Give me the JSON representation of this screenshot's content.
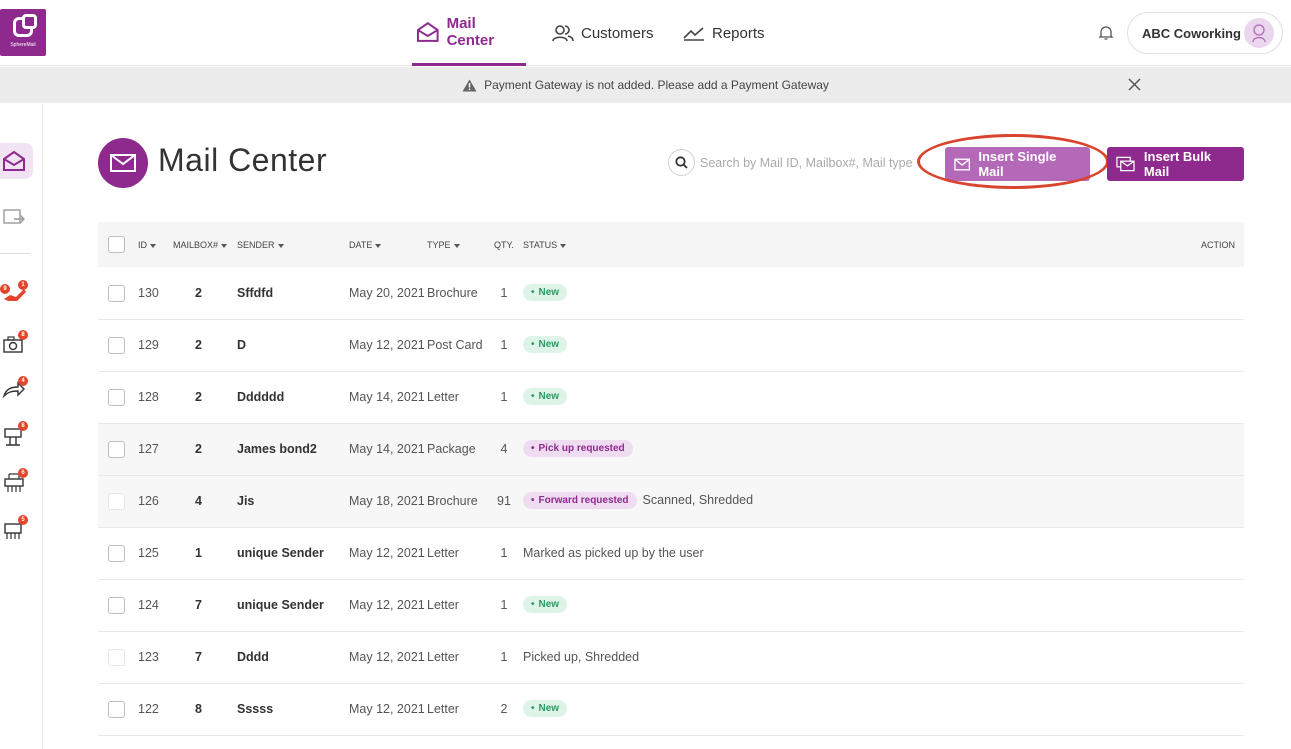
{
  "app": {
    "logo_text": "SphereMail",
    "brand_color": "#8e2a8e",
    "accent_light": "#b369b8"
  },
  "nav": {
    "items": [
      {
        "label": "Mail Center",
        "icon": "envelope-icon",
        "active": true
      },
      {
        "label": "Customers",
        "icon": "users-icon"
      },
      {
        "label": "Reports",
        "icon": "trend-line-icon"
      }
    ],
    "account_name": "ABC Coworking"
  },
  "banner": {
    "message": "Payment Gateway is not added. Please add a  Payment Gateway"
  },
  "rail": {
    "badges": [
      "9",
      "1",
      "8",
      "4",
      "8",
      "6",
      "5"
    ]
  },
  "page": {
    "title": "Mail Center",
    "search_placeholder": "Search by Mail ID, Mailbox#, Mail type",
    "insert_single_label": "Insert Single Mail",
    "insert_bulk_label": "Insert Bulk Mail"
  },
  "table": {
    "headers": {
      "id": "ID",
      "mailbox": "MAILBOX#",
      "sender": "SENDER",
      "date": "DATE",
      "type": "TYPE",
      "qty": "QTY.",
      "status": "STATUS",
      "action": "ACTION"
    },
    "rows": [
      {
        "id": "130",
        "mailbox": "2",
        "sender": "Sffdfd",
        "date": "May 20, 2021",
        "type": "Brochure",
        "qty": "1",
        "status": "New",
        "extra": ""
      },
      {
        "id": "129",
        "mailbox": "2",
        "sender": "D",
        "date": "May 12, 2021",
        "type": "Post Card",
        "qty": "1",
        "status": "New",
        "extra": ""
      },
      {
        "id": "128",
        "mailbox": "2",
        "sender": "Dddddd",
        "date": "May 14, 2021",
        "type": "Letter",
        "qty": "1",
        "status": "New",
        "extra": ""
      },
      {
        "id": "127",
        "mailbox": "2",
        "sender": "James bond2",
        "date": "May 14, 2021",
        "type": "Package",
        "qty": "4",
        "status": "Pick up requested",
        "extra": ""
      },
      {
        "id": "126",
        "mailbox": "4",
        "sender": "Jis",
        "date": "May 18, 2021",
        "type": "Brochure",
        "qty": "91",
        "status": "Forward requested",
        "extra": "Scanned,  Shredded"
      },
      {
        "id": "125",
        "mailbox": "1",
        "sender": "unique Sender",
        "date": "May 12, 2021",
        "type": "Letter",
        "qty": "1",
        "status": "",
        "extra": "Marked as picked up by the user"
      },
      {
        "id": "124",
        "mailbox": "7",
        "sender": "unique Sender",
        "date": "May 12, 2021",
        "type": "Letter",
        "qty": "1",
        "status": "New",
        "extra": ""
      },
      {
        "id": "123",
        "mailbox": "7",
        "sender": "Dddd",
        "date": "May 12, 2021",
        "type": "Letter",
        "qty": "1",
        "status": "",
        "extra": "Picked up,  Shredded"
      },
      {
        "id": "122",
        "mailbox": "8",
        "sender": "Sssss",
        "date": "May 12, 2021",
        "type": "Letter",
        "qty": "2",
        "status": "New",
        "extra": ""
      }
    ]
  }
}
